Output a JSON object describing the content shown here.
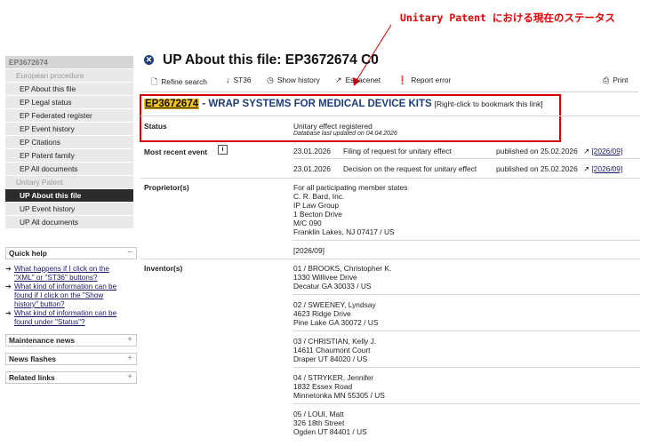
{
  "annotation": {
    "text": "Unitary Patent における現在のステータス",
    "color": "#e00000"
  },
  "sidebar": {
    "publication": "EP3672674",
    "section1": "European procedure",
    "items1": [
      "EP About this file",
      "EP Legal status",
      "EP Federated register",
      "EP Event history",
      "EP Citations",
      "EP Patent family",
      "EP All documents"
    ],
    "section2": "Unitary Patent",
    "items2": [
      "UP About this file",
      "UP Event history",
      "UP All documents"
    ],
    "active": "UP About this file"
  },
  "quick_help": {
    "title": "Quick help",
    "toggle": "−",
    "links": [
      [
        "What happens if I click on the",
        "\"XML\" or \"ST36\" buttons?"
      ],
      [
        "What kind of information can be",
        "found if I click on the \"Show",
        "history\" button?"
      ],
      [
        "What kind of information can be",
        "found under \"Status\"?"
      ]
    ]
  },
  "boxes": [
    {
      "title": "Maintenance news",
      "toggle": "+"
    },
    {
      "title": "News flashes",
      "toggle": "+"
    },
    {
      "title": "Related links",
      "toggle": "+"
    }
  ],
  "title": "UP About this file: EP3672674  C0",
  "toolbar": {
    "refine": "Refine search",
    "st36": "ST36",
    "history": "Show history",
    "espacenet": "Espacenet",
    "report": "Report error",
    "print": "Print"
  },
  "headline": {
    "number": "EP3672674",
    "title": " - WRAP SYSTEMS FOR MEDICAL DEVICE KITS",
    "bookmark": "[Right-click to bookmark this link]"
  },
  "status": {
    "label": "Status",
    "value": "Unitary effect registered",
    "updated": "Database last updated on 04.04.2026"
  },
  "recent": {
    "label": "Most recent event",
    "events": [
      {
        "date": "23.01.2026",
        "desc": "Filing of request for unitary effect",
        "published": "published on 25.02.2026",
        "ref": "[2026/09]"
      },
      {
        "date": "23.01.2026",
        "desc": "Decision on the request for unitary effect",
        "published": "published on 25.02.2026",
        "ref": "[2026/09]"
      }
    ]
  },
  "proprietor": {
    "label": "Proprietor(s)",
    "lines": [
      "For all participating member states",
      "C. R. Bard, Inc.",
      "IP Law Group",
      "1 Becton Drive",
      "M/C 090",
      "Franklin Lakes, NJ 07417 / US"
    ],
    "ref": "[2026/09]"
  },
  "inventors": {
    "label": "Inventor(s)",
    "list": [
      [
        "01 / BROOKS, Christopher K.",
        "1330 Willivee Drive",
        "Decatur GA 30033 / US"
      ],
      [
        "02 / SWEENEY, Lyndsay",
        "4623 Ridge Drive",
        "Pine Lake GA 30072 / US"
      ],
      [
        "03 / CHRISTIAN, Kelly J.",
        "14611 Chaumont Court",
        "Draper UT 84020 / US"
      ],
      [
        "04 / STRYKER, Jennifer",
        "1832 Essex Road",
        "Minnetonka MN 55305 / US"
      ],
      [
        "05 / LOUI, Matt",
        "326 18th Street",
        "Ogden UT 84401 / US"
      ]
    ]
  }
}
